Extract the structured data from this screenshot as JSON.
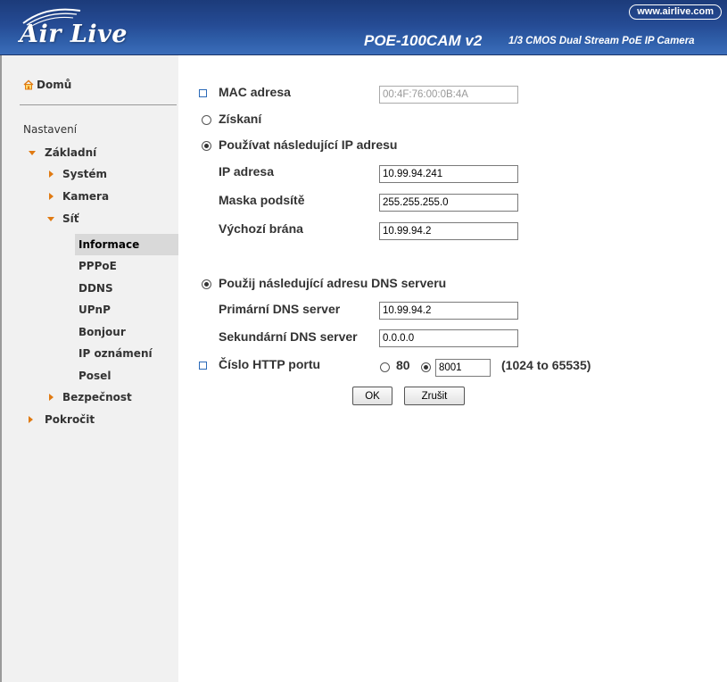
{
  "header": {
    "logo_text": "Air Live",
    "url": "www.airlive.com",
    "model_name": "POE-100CAM v2",
    "model_desc": "1/3 CMOS Dual Stream PoE IP Camera"
  },
  "sidebar": {
    "home": "Domů",
    "settings": "Nastavení",
    "basic": "Základní",
    "system": "Systém",
    "camera": "Kamera",
    "network": "Síť",
    "network_items": [
      "Informace",
      "PPPoE",
      "DDNS",
      "UPnP",
      "Bonjour",
      "IP oznámení",
      "Posel"
    ],
    "security": "Bezpečnost",
    "advanced": "Pokročit",
    "active_item": "Informace"
  },
  "form": {
    "mac_label": "MAC adresa",
    "mac_value": "00:4F:76:00:0B:4A",
    "obtain_label": "Získaní",
    "use_ip_label": "Používat následující IP adresu",
    "ip_label": "IP adresa",
    "ip_value": "10.99.94.241",
    "mask_label": "Maska podsítě",
    "mask_value": "255.255.255.0",
    "gateway_label": "Výchozí brána",
    "gateway_value": "10.99.94.2",
    "dns_label": "Použij následující adresu DNS serveru",
    "primary_dns_label": "Primární DNS server",
    "primary_dns_value": "10.99.94.2",
    "secondary_dns_label": "Sekundární DNS server",
    "secondary_dns_value": "0.0.0.0",
    "http_port_label": "Číslo HTTP portu",
    "http_port_default": "80",
    "http_port_value": "8001",
    "http_port_range": "(1024 to 65535)",
    "ok_button": "OK",
    "cancel_button": "Zrušit"
  },
  "colors": {
    "header_blue": "#254b94",
    "sidebar_bg": "#f1f1f1",
    "accent_orange": "#e07a12",
    "checkbox_blue": "#2b6ab8"
  }
}
